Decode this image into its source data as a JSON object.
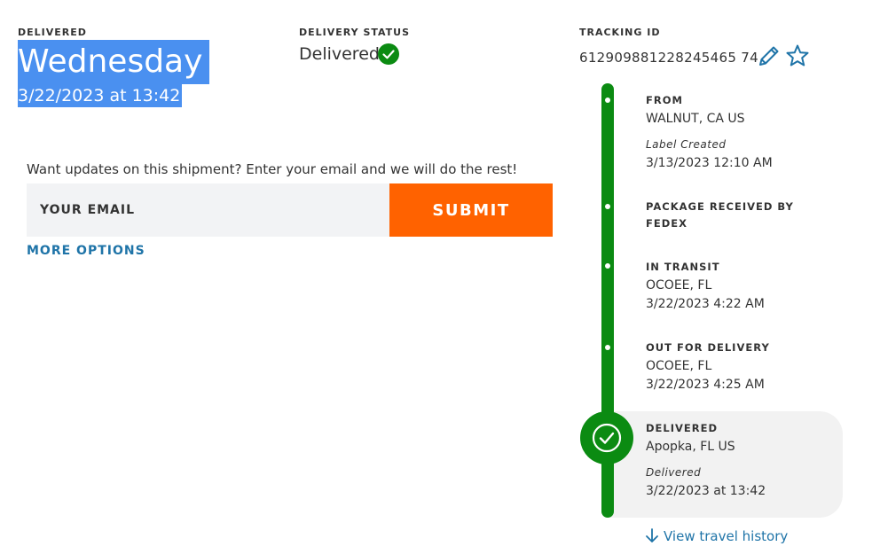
{
  "left": {
    "delivered_label": "DELIVERED",
    "day": "Wednesday",
    "date_time": "3/22/2023 at 13:42"
  },
  "status": {
    "label": "DELIVERY STATUS",
    "value": "Delivered",
    "icon": "check-circle-icon",
    "color": "#0b8b12"
  },
  "tracking": {
    "label": "TRACKING ID",
    "number": "612909881228245465 74",
    "edit_icon": "pencil-icon",
    "favorite_icon": "star-icon",
    "icon_color": "#1f74a8"
  },
  "updates": {
    "prompt": "Want updates on this shipment? Enter your email and we will do the rest!",
    "email_placeholder": "YOUR EMAIL",
    "submit_label": "SUBMIT",
    "more_options": "MORE OPTIONS",
    "submit_color": "#ff6200"
  },
  "timeline": {
    "events": [
      {
        "title": "FROM",
        "location": "WALNUT, CA US",
        "note": "Label Created",
        "time": "3/13/2023 12:10 AM"
      },
      {
        "title": "PACKAGE RECEIVED BY FEDEX"
      },
      {
        "title": "IN TRANSIT",
        "location": "OCOEE, FL",
        "time": "3/22/2023 4:22 AM"
      },
      {
        "title": "OUT FOR DELIVERY",
        "location": "OCOEE, FL",
        "time": "3/22/2023 4:25 AM"
      },
      {
        "title": "DELIVERED",
        "location": "Apopka, FL US",
        "note": "Delivered",
        "time": "3/22/2023 at 13:42"
      }
    ],
    "travel_history_link": "View travel history",
    "arrow_icon": "arrow-down-icon"
  }
}
